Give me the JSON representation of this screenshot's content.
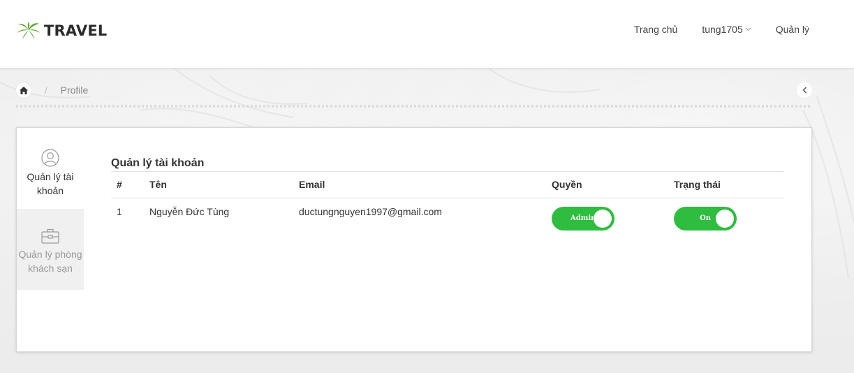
{
  "brand": {
    "name": "TRAVEL",
    "logo_icon": "palm-leaf-icon",
    "logo_color": "#5aa830"
  },
  "nav": {
    "home_label": "Trang chủ",
    "user_label": "tung1705",
    "manage_label": "Quản lý"
  },
  "breadcrumb": {
    "home_icon": "home-icon",
    "separator": "/",
    "current": "Profile"
  },
  "sidebar": {
    "items": [
      {
        "label": "Quản lý tài khoản",
        "icon": "user-circle-icon",
        "active": true
      },
      {
        "label": "Quản lý phòng khách sạn",
        "icon": "briefcase-icon",
        "active": false
      }
    ]
  },
  "accounts": {
    "title": "Quản lý tài khoản",
    "columns": [
      "#",
      "Tên",
      "Email",
      "Quyền",
      "Trạng thái"
    ],
    "rows": [
      {
        "num": "1",
        "name": "Nguyễn Đức Tùng",
        "email": "ductungnguyen1997@gmail.com",
        "role_label": "Admin",
        "status_label": "On"
      }
    ]
  },
  "colors": {
    "toggle_on": "#2ebd3f",
    "card_background": "#ffffff",
    "page_background": "#ececec"
  }
}
